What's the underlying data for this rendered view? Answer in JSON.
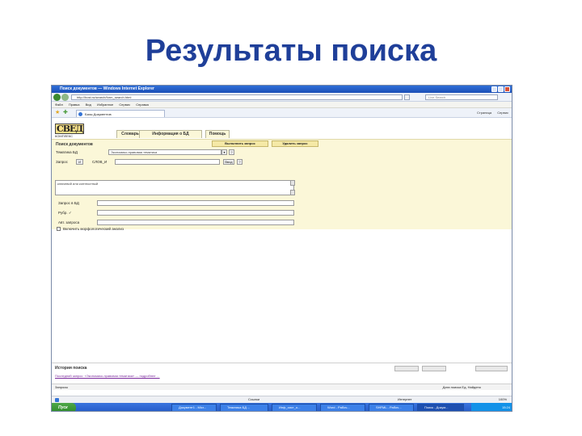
{
  "slide": {
    "title": "Результаты поиска"
  },
  "browser": {
    "window_title": "Поиск документов — Windows Internet Explorer",
    "address": "http://host.ru/search/form_search.html",
    "search_placeholder": "Live Search",
    "menu": [
      "Файл",
      "Правка",
      "Вид",
      "Избранное",
      "Сервис",
      "Справка"
    ],
    "tab_label": "Базы Документов",
    "tools": [
      "Страница",
      "Сервис"
    ]
  },
  "app": {
    "logo_text": "СВЕД",
    "logo_sub": "КОМПЛЕКС",
    "tabs": [
      "Словарь",
      "Информация о БД",
      "Помощь"
    ],
    "section_title": "Поиск документов",
    "execute_button": "Выполнить запрос",
    "clear_button": "Удалить запрос",
    "db_label": "Тематика БД",
    "db_value": "Экономико-правовая тематика",
    "query_label": "Запрос",
    "query_operator": "И",
    "query_scope": "СЛОВ_И",
    "query_confirm": "Ввод",
    "textarea_value": "ключевой или контекстный",
    "row1_label": "Запрос в БД",
    "row2_label": "Рубр. ✓",
    "row3_label": "Авт. запроса",
    "checkbox_label": "Включить морфологический анализ"
  },
  "history": {
    "title": "История поиска",
    "link_text": "Последний запрос: «Экономико-правовая тематика» — подробнее …",
    "bar_query": "Запросы",
    "bar_results": "Дата поиска   Ед. Найдено"
  },
  "status": {
    "left": "",
    "ref": "Ссылки",
    "zone": "Интернет",
    "zoom": "100%"
  },
  "taskbar": {
    "start": "Пуск",
    "items": [
      "Документ1 - Micr...",
      "Тематика БД ...",
      "Инф_сист_о...",
      "Word - Рабоч...",
      "SHFML - Рабоч...",
      "Поиск - Докум..."
    ],
    "clock": "15:24"
  }
}
